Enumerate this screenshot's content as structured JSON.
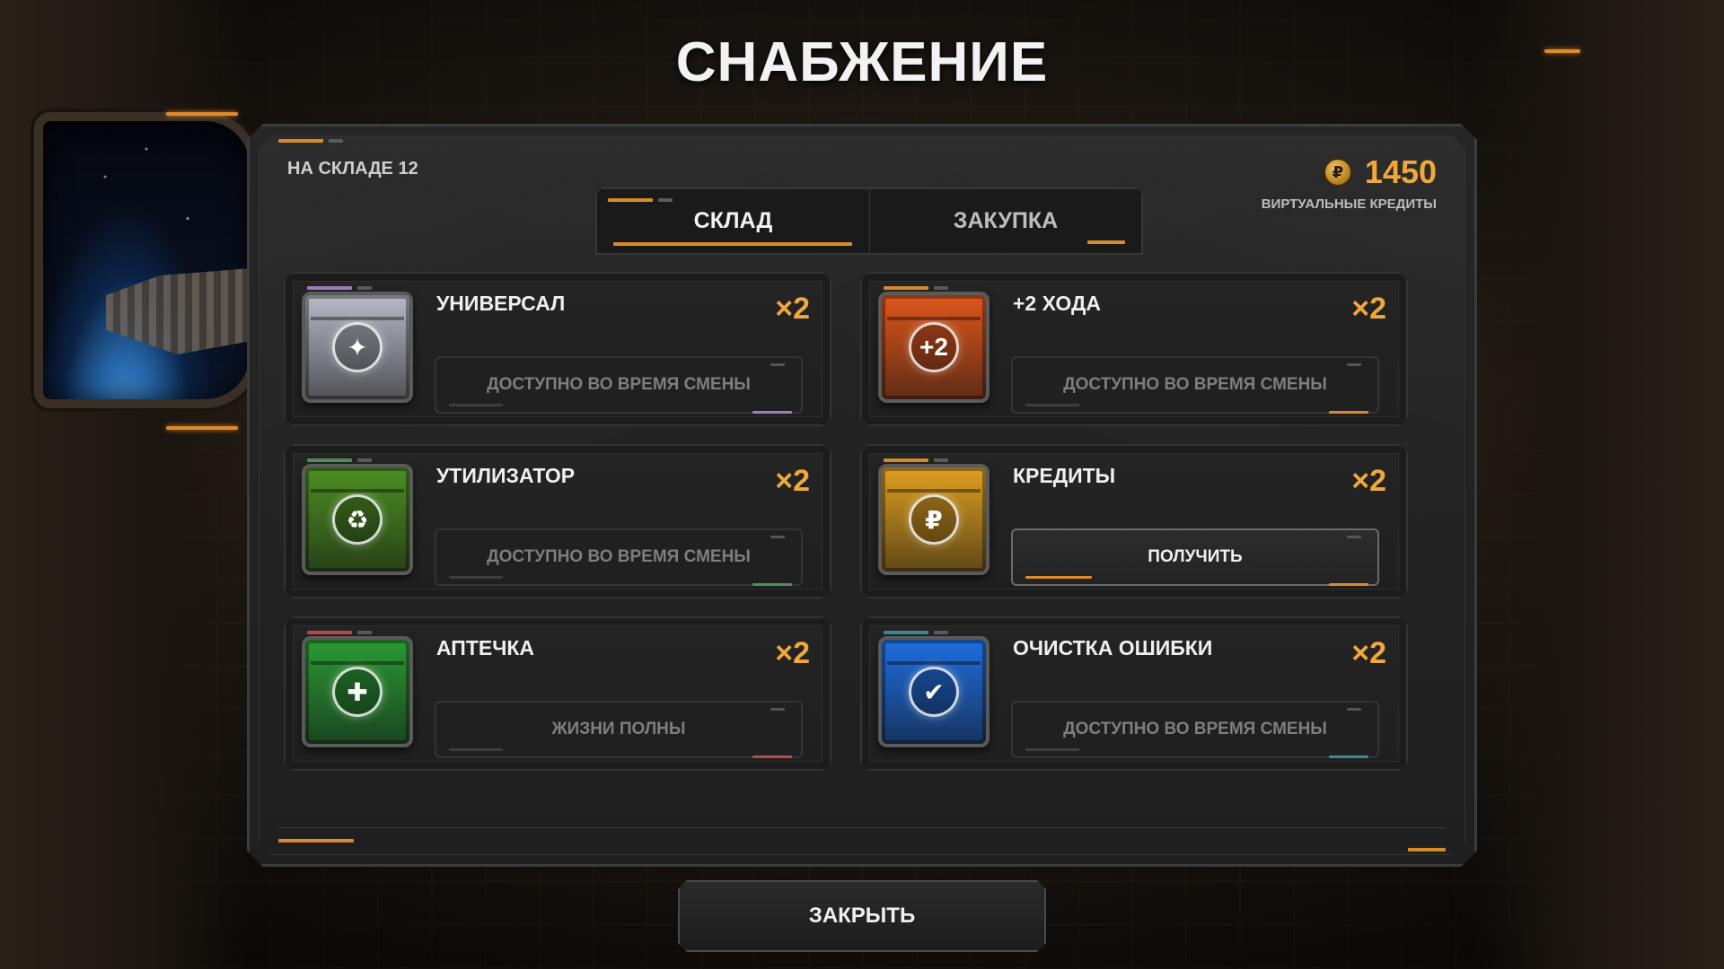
{
  "title": "СНАБЖЕНИЕ",
  "stock_label": "НА СКЛАДЕ 12",
  "credits": {
    "value": "1450",
    "label": "ВИРТУАЛЬНЫЕ КРЕДИТЫ",
    "coin_icon": "credit-coin-icon"
  },
  "tabs": [
    {
      "label": "СКЛАД",
      "active": true
    },
    {
      "label": "ЗАКУПКА",
      "active": false
    }
  ],
  "items": [
    {
      "name": "УНИВЕРСАЛ",
      "multiplier": "×2",
      "button": "ДОСТУПНО ВО ВРЕМЯ СМЕНЫ",
      "active": false,
      "color": "#b9b9c8",
      "accent": "#9a7fb8",
      "icon": "rainbow-crystal-icon",
      "emblem": "✦"
    },
    {
      "name": "+2 ХОДА",
      "multiplier": "×2",
      "button": "ДОСТУПНО ВО ВРЕМЯ СМЕНЫ",
      "active": false,
      "color": "#e0561c",
      "accent": "#d98a2b",
      "icon": "plus-two-moves-icon",
      "emblem": "+2"
    },
    {
      "name": "УТИЛИЗАТОР",
      "multiplier": "×2",
      "button": "ДОСТУПНО ВО ВРЕМЯ СМЕНЫ",
      "active": false,
      "color": "#4c8f22",
      "accent": "#4e8f5a",
      "icon": "trash-bin-icon",
      "emblem": "♻"
    },
    {
      "name": "КРЕДИТЫ",
      "multiplier": "×2",
      "button": "ПОЛУЧИТЬ",
      "active": true,
      "color": "#e0a020",
      "accent": "#d98a2b",
      "icon": "money-bag-icon",
      "emblem": "₽"
    },
    {
      "name": "АПТЕЧКА",
      "multiplier": "×2",
      "button": "ЖИЗНИ ПОЛНЫ",
      "active": false,
      "color": "#2a9a34",
      "accent": "#b84a4a",
      "icon": "heart-medkit-icon",
      "emblem": "✚"
    },
    {
      "name": "ОЧИСТКА ОШИБКИ",
      "multiplier": "×2",
      "button": "ДОСТУПНО ВО ВРЕМЯ СМЕНЫ",
      "active": false,
      "color": "#1f6ee0",
      "accent": "#3a8a8f",
      "icon": "eraser-check-icon",
      "emblem": "✔"
    }
  ],
  "close_label": "ЗАКРЫТЬ"
}
